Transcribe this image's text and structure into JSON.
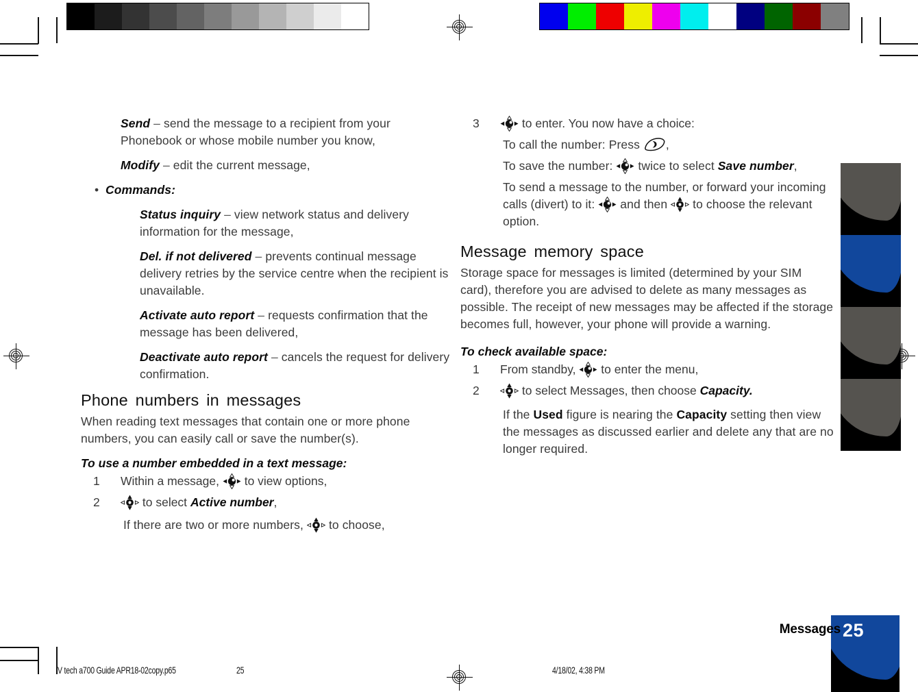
{
  "document": {
    "section_label": "Messages",
    "page_number": "25"
  },
  "footer": {
    "file_name": "V tech a700 Guide APR18-02copy.p65",
    "page": "25",
    "timestamp": "4/18/02, 4:38 PM"
  },
  "calibration": {
    "gray_wedge": [
      "#000000",
      "#1c1c1c",
      "#333333",
      "#4c4c4c",
      "#636363",
      "#7d7d7d",
      "#999999",
      "#b4b4b4",
      "#cfcfcf",
      "#ebebeb",
      "#ffffff"
    ],
    "color_bars": [
      "#0000ee",
      "#00ee00",
      "#ee0000",
      "#eeee00",
      "#ee00ee",
      "#00eeee",
      "#ffffff",
      "#000080",
      "#006400",
      "#8b0000",
      "#808080"
    ]
  },
  "left_column": {
    "definitions": [
      {
        "term": "Send",
        "dash": "–",
        "text": "send the message to a recipient from your Phonebook or whose mobile number you know,"
      },
      {
        "term": "Modify",
        "dash": "–",
        "text": "edit the current message,"
      }
    ],
    "bullet": {
      "marker": "•",
      "label": "Commands:"
    },
    "commands": [
      {
        "term": "Status inquiry",
        "dash": "–",
        "text": "view network status and delivery information for the message,"
      },
      {
        "term": "Del. if not delivered",
        "dash": "–",
        "text": "prevents continual message delivery retries by the service centre when the recipient is unavailable."
      },
      {
        "term": "Activate auto report",
        "dash": "–",
        "text": "requests confirmation that the message has been delivered,"
      },
      {
        "term": "Deactivate auto report",
        "dash": "–",
        "text": "cancels the request for delivery confirmation."
      }
    ],
    "heading": "Phone numbers in messages",
    "intro": "When reading text messages that contain one or more phone numbers, you can easily call or save the number(s).",
    "procedure_title": "To use a number embedded in a text message:",
    "steps": [
      {
        "num": "1",
        "pre": "Within a message,",
        "icon": "navkey-select-icon",
        "post": "to view options,"
      },
      {
        "num": "2",
        "pre": "",
        "icon": "navkey-updown-icon",
        "post": "to select",
        "emphasis": "Active number",
        "tail": ","
      }
    ],
    "note": {
      "pre": "If there are two or more numbers,",
      "icon": "navkey-updown-icon",
      "post": "to choose,"
    }
  },
  "right_column": {
    "step3": {
      "num": "3",
      "icon": "navkey-select-icon",
      "text": "to enter. You now have a choice:"
    },
    "choices": [
      {
        "pre": "To call the number: Press",
        "icon": "call-key-icon",
        "post": ","
      },
      {
        "pre": "To save the number:",
        "icon": "navkey-select-icon",
        "post": "twice to select",
        "emphasis": "Save number",
        "tail": ","
      },
      {
        "pre": "To send a message to the number, or forward your incoming calls (divert) to it:",
        "icon": "navkey-select-icon",
        "mid": "and then",
        "icon2": "navkey-updown-icon",
        "post": "to choose the relevant option."
      }
    ],
    "heading": "Message memory space",
    "intro": "Storage space for messages is limited (determined by your SIM card), therefore you are advised to delete as many messages as possible. The receipt of new messages may be affected if the storage becomes full, however, your phone will provide a warning.",
    "procedure_title": "To check available space:",
    "steps": [
      {
        "num": "1",
        "pre": "From standby,",
        "icon": "navkey-select-icon",
        "post": "to enter the menu,"
      },
      {
        "num": "2",
        "pre": "",
        "icon": "navkey-updown-icon",
        "post": "to select Messages, then choose",
        "emphasis": "Capacity.",
        "tail": ""
      }
    ],
    "note": {
      "pre": "If the",
      "emph1": "Used",
      "mid": "figure is nearing the",
      "emph2": "Capacity",
      "post": "setting then view the messages as discussed earlier and delete any that are no longer required."
    }
  },
  "side_tabs": {
    "count": 4,
    "active_index": 1,
    "active_color": "#11479c",
    "inactive_color": "#55534f"
  }
}
